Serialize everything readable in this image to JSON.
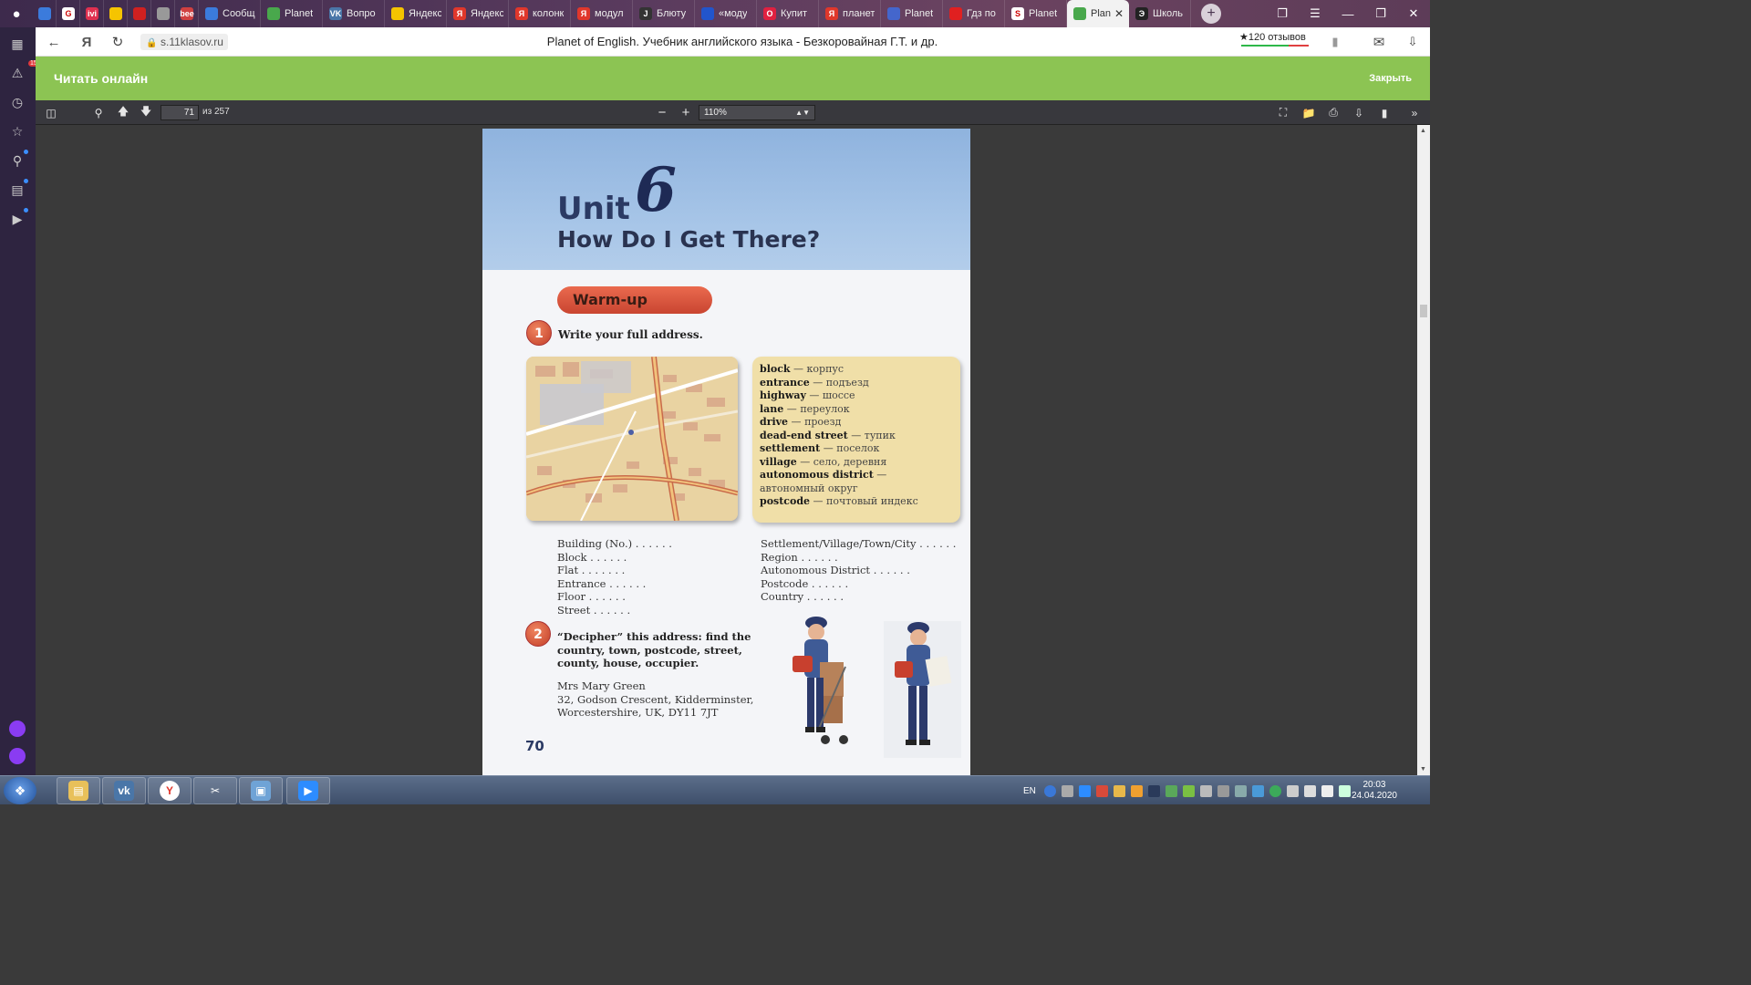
{
  "browser": {
    "tabs": [
      {
        "label": "",
        "favicon": "chat",
        "color": "#3b7bdc"
      },
      {
        "label": "",
        "favicon": "G",
        "color": "#ffffff"
      },
      {
        "label": "",
        "favicon": "ivi",
        "color": "#e03050"
      },
      {
        "label": "",
        "favicon": "yandex-map",
        "color": "#f5c400"
      },
      {
        "label": "",
        "favicon": "umbrella",
        "color": "#d02020"
      },
      {
        "label": "",
        "favicon": "apple",
        "color": "#999999"
      },
      {
        "label": "",
        "favicon": "bee",
        "color": "#d04040"
      },
      {
        "label": "Сообщ",
        "favicon": "chat",
        "color": "#3b7bdc"
      },
      {
        "label": "Planet",
        "favicon": "book",
        "color": "#49a84c"
      },
      {
        "label": "Вопро",
        "favicon": "VK",
        "color": "#4a76a8"
      },
      {
        "label": "Яндекс",
        "favicon": "crown",
        "color": "#f5c400"
      },
      {
        "label": "Яндекс",
        "favicon": "Я",
        "color": "#e0372b"
      },
      {
        "label": "колонк",
        "favicon": "Я",
        "color": "#e0372b"
      },
      {
        "label": "модул",
        "favicon": "Я",
        "color": "#e0372b"
      },
      {
        "label": "Блюту",
        "favicon": "J",
        "color": "#333333"
      },
      {
        "label": "«моду",
        "favicon": "tick",
        "color": "#2255cc"
      },
      {
        "label": "Купит",
        "favicon": "O",
        "color": "#e02040"
      },
      {
        "label": "планет",
        "favicon": "Я",
        "color": "#e0372b"
      },
      {
        "label": "Planet",
        "favicon": "flag",
        "color": "#4466cc"
      },
      {
        "label": "Гдз по",
        "favicon": "check",
        "color": "#e02020"
      },
      {
        "label": "Planet",
        "favicon": "S",
        "color": "#ffffff"
      },
      {
        "label": "Plan",
        "favicon": "book",
        "color": "#49a84c",
        "active": true
      },
      {
        "label": "Школь",
        "favicon": "Э",
        "color": "#222222"
      }
    ],
    "domain": "s.11klasov.ru",
    "page_title": "Planet of English. Учебник английского языка - Безкоровайная Г.Т. и др.",
    "reviews": "★120 отзывов",
    "notification_count": "15",
    "extension_badge": "1"
  },
  "banner": {
    "title": "Читать онлайн",
    "close_label": "Закрыть"
  },
  "pdf_toolbar": {
    "page_current": "71",
    "page_total_label": "из 257",
    "zoom": "110%"
  },
  "page": {
    "unit_label": "Unit",
    "unit_number": "6",
    "heading": "How Do I Get There?",
    "warmup_label": "Warm-up",
    "ex1_number": "1",
    "ex1_text": "Write your full address.",
    "vocab": [
      {
        "term": "block",
        "translation": "корпус"
      },
      {
        "term": "entrance",
        "translation": "подъезд"
      },
      {
        "term": "highway",
        "translation": "шоссе"
      },
      {
        "term": "lane",
        "translation": "переулок"
      },
      {
        "term": "drive",
        "translation": "проезд"
      },
      {
        "term": "dead-end street",
        "translation": "тупик"
      },
      {
        "term": "settlement",
        "translation": "поселок"
      },
      {
        "term": "village",
        "translation": "село, деревня"
      },
      {
        "term": "autonomous district",
        "translation": "автономный округ"
      },
      {
        "term": "postcode",
        "translation": "почтовый индекс"
      }
    ],
    "fill_left": [
      "Building (No.) . . . . . .",
      "Block . . . . . .",
      "Flat . . . . . . .",
      "Entrance . . . . . .",
      "Floor . . . . . .",
      "Street . . . . . ."
    ],
    "fill_right": [
      "Settlement/Village/Town/City . . . . . .",
      "Region . . . . . .",
      "Autonomous District . . . . . .",
      "Postcode . . . . . .",
      "Country . . . . . ."
    ],
    "ex2_number": "2",
    "ex2_text": "“Decipher” this address: find the country, town, postcode, street, county, house, occupier.",
    "address_lines": [
      "Mrs Mary Green",
      "32, Godson Crescent, Kidderminster,",
      "Worcestershire, UK, DY11 7JT"
    ],
    "page_number": "70"
  },
  "taskbar": {
    "apps": [
      "file-explorer",
      "vk",
      "yandex-browser",
      "scissors-tool",
      "photo-viewer",
      "zoom"
    ],
    "lang": "EN",
    "time": "20:03",
    "date": "24.04.2020"
  }
}
